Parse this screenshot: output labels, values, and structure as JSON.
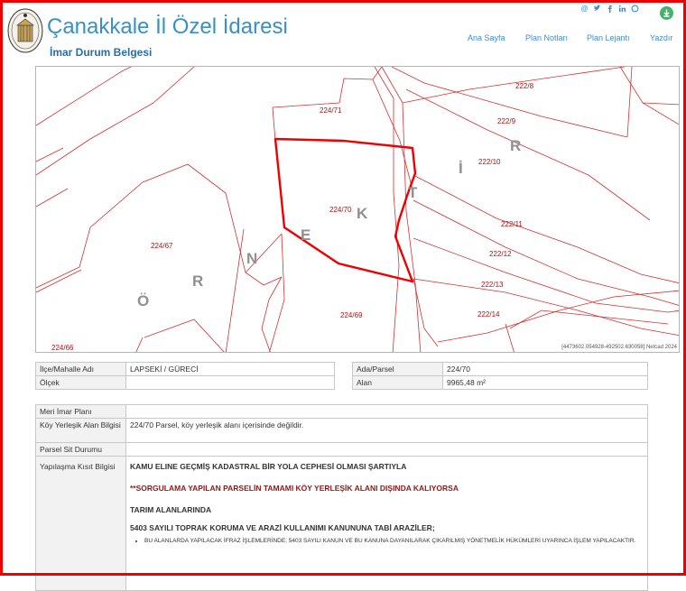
{
  "header": {
    "title": "Çanakkale İl Özel İdaresi",
    "subtitle": "İmar Durum Belgesi"
  },
  "nav": {
    "items": [
      {
        "label": "Ana Sayfa"
      },
      {
        "label": "Plan Notları"
      },
      {
        "label": "Plan Lejantı"
      },
      {
        "label": "Yazdır"
      }
    ]
  },
  "social": [
    "at-icon",
    "twitter-icon",
    "facebook-icon",
    "linkedin-icon",
    "whatsapp-icon"
  ],
  "map": {
    "parcels": {
      "p224_71": "224/71",
      "p224_70": "224/70",
      "p224_67": "224/67",
      "p224_69": "224/69",
      "p224_66": "224/66",
      "p222_8": "222/8",
      "p222_9": "222/9",
      "p222_10": "222/10",
      "p222_11": "222/11",
      "p222_12": "222/12",
      "p222_13": "222/13",
      "p222_14": "222/14"
    },
    "watermark": [
      "Ö",
      "R",
      "N",
      "E",
      "K",
      "T",
      "İ",
      "R"
    ],
    "coords": "[4473602.054928-492502.630058] Netcad 2024"
  },
  "info": {
    "ilce_label": "İlçe/Mahalle Adı",
    "ilce_value": "LAPSEKİ / GÜRECİ",
    "olcek_label": "Ölçek",
    "olcek_value": "",
    "ada_label": "Ada/Parsel",
    "ada_value": "224/70",
    "alan_label": "Alan",
    "alan_value": "9965,48 m²",
    "meri_label": "Meri İmar Planı",
    "meri_value": "",
    "koy_label": "Köy Yerleşik Alan Bilgisi",
    "koy_value": "224/70 Parsel, köy yerleşik alanı içerisinde değildir.",
    "sit_label": "Parsel Sit Durumu",
    "sit_value": "",
    "yk_label": "Yapılaşma Kısıt Bilgisi",
    "yk_line1": "KAMU ELINE GEÇMİŞ KADASTRAL BİR YOLA CEPHESİ OLMASI ŞARTIYLA",
    "yk_line2": "**SORGULAMA YAPILAN PARSELİN TAMAMI KÖY YERLEŞİK ALANI DIŞINDA KALIYORSA",
    "yk_line3": "TARIM ALANLARINDA",
    "yk_line4": "5403 SAYILI TOPRAK KORUMA VE ARAZİ KULLANIMI KANUNUNA TABİ ARAZİLER;",
    "yk_bullet": "BU ALANLARDA YAPILACAK İFRAZ İŞLEMLERİNDE; 5403 SAYILI KANUN VE BU KANUNA DAYANILARAK ÇIKARILMIŞ YÖNETMELİK HÜKÜMLERİ UYARINCA İŞLEM YAPILACAKTIR."
  }
}
